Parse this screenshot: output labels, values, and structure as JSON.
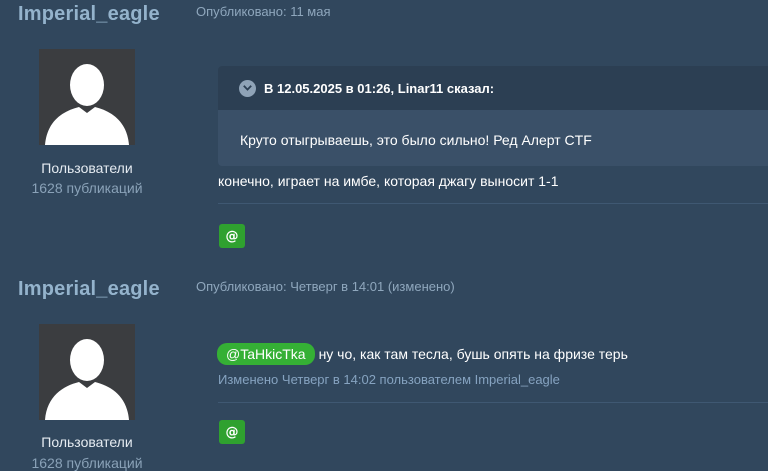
{
  "posts": [
    {
      "author": "Imperial_eagle",
      "published": "Опубликовано: 11 мая",
      "group": "Пользователи",
      "post_count": "1628 публикаций",
      "quote": {
        "header": "В 12.05.2025 в 01:26, Linar11 сказал:",
        "text": "Круто отыгрываешь, это было сильно! Ред Алерт CTF"
      },
      "text": "конечно, играет на имбе, которая джагу выносит 1-1",
      "mention_button": "@"
    },
    {
      "author": "Imperial_eagle",
      "published": "Опубликовано: Четверг в 14:01 (изменено)",
      "group": "Пользователи",
      "post_count": "1628 публикаций",
      "mention": "@TaHkicTka",
      "text": "ну чо, как там тесла, бушь опять на фризе терь",
      "edited_note": "Изменено Четверг в 14:02 пользователем Imperial_eagle",
      "mention_button": "@"
    }
  ],
  "icons": {
    "avatar": "default-user-silhouette",
    "quote_toggle": "chevron-down-icon"
  }
}
